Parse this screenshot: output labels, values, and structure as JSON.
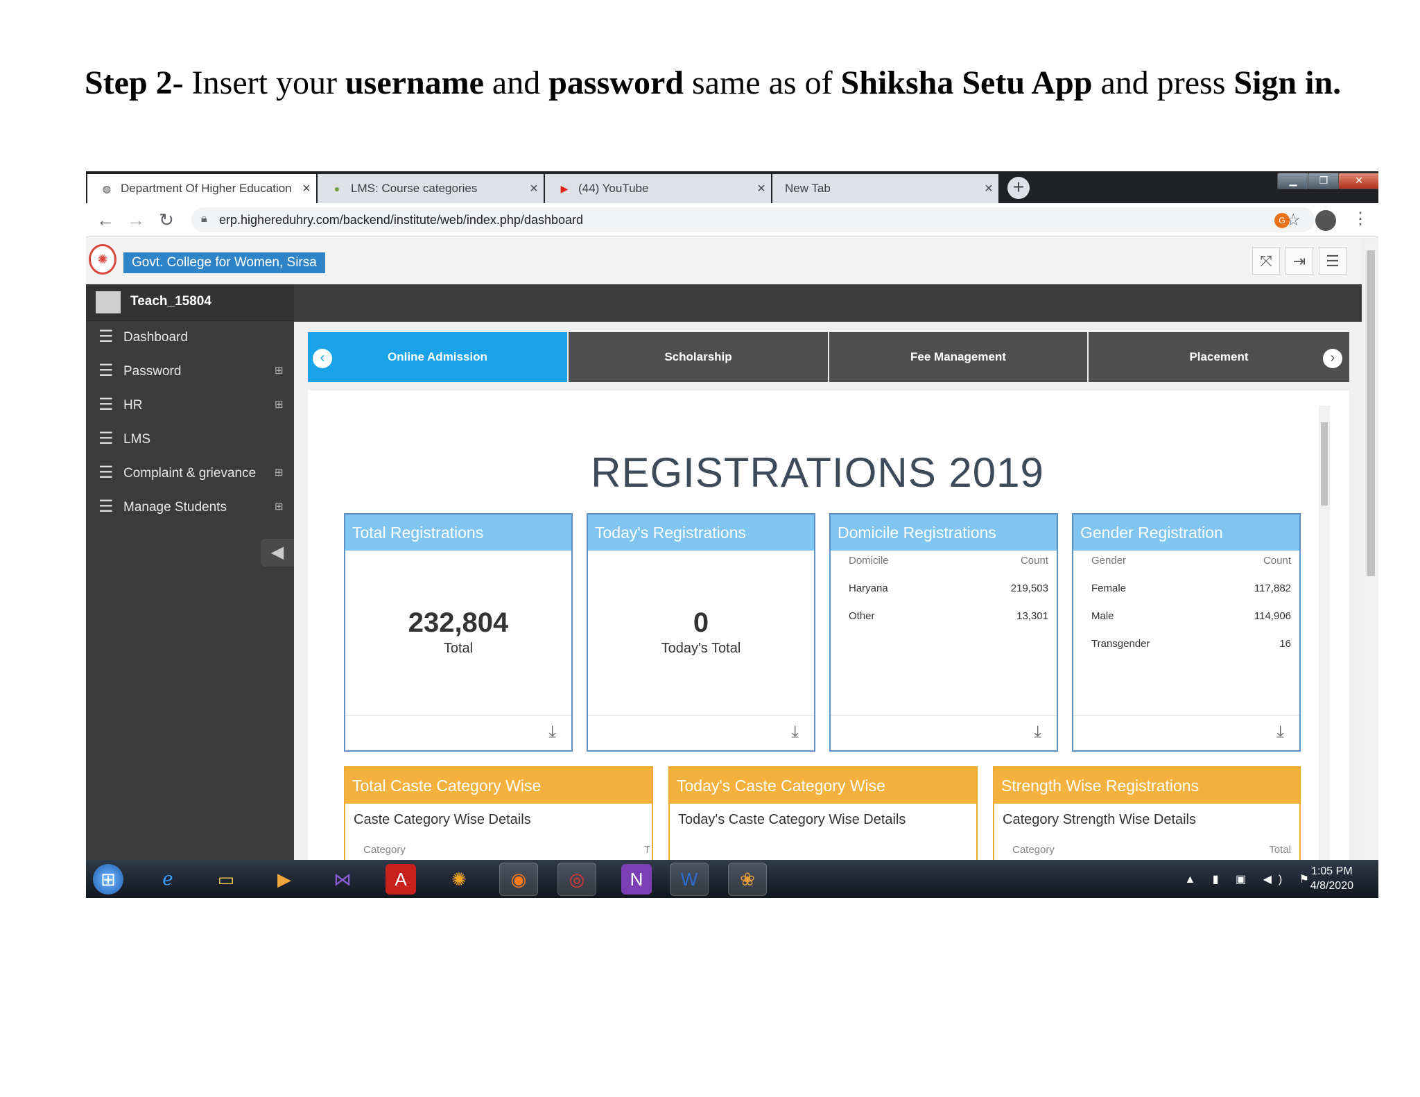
{
  "instruction": {
    "step_label": "Step 2-",
    "text_1": " Insert your ",
    "bold_1": "username",
    "text_2": " and ",
    "bold_2": "password",
    "text_3": " same as of ",
    "bold_3": "Shiksha Setu App",
    "text_4": " and press ",
    "bold_4": "Sign in."
  },
  "browser": {
    "tabs": [
      {
        "title": "Department Of Higher Education",
        "icon": "globe-icon",
        "active": true
      },
      {
        "title": "LMS: Course categories",
        "icon": "moodle-icon",
        "active": false
      },
      {
        "title": "(44) YouTube",
        "icon": "youtube-icon",
        "active": false
      },
      {
        "title": "New Tab",
        "icon": "none",
        "active": false
      }
    ],
    "url": "erp.higheredu hry.com/backend/institute/web/index.php/dashboard",
    "url_display": "erp.higheredu​hry.com/backend/institute/web/index.php/dashboard"
  },
  "app": {
    "college_name": "Govt. College for Women, Sirsa",
    "user": "Teach_15804",
    "menu": [
      {
        "label": "Dashboard",
        "expandable": false
      },
      {
        "label": "Password",
        "expandable": true
      },
      {
        "label": "HR",
        "expandable": true
      },
      {
        "label": "LMS",
        "expandable": false
      },
      {
        "label": "Complaint & grievance",
        "expandable": true
      },
      {
        "label": "Manage Students",
        "expandable": true
      }
    ],
    "modules": [
      "Online Admission",
      "Scholarship",
      "Fee Management",
      "Placement"
    ],
    "active_module": "Online Admission",
    "page_title": "REGISTRATIONS 2019",
    "cards": {
      "total": {
        "title": "Total Registrations",
        "value": "232,804",
        "caption": "Total"
      },
      "today": {
        "title": "Today's Registrations",
        "value": "0",
        "caption": "Today's Total"
      },
      "domicile": {
        "title": "Domicile Registrations",
        "col1": "Domicile",
        "col2": "Count",
        "rows": [
          {
            "name": "Haryana",
            "count": "219,503"
          },
          {
            "name": "Other",
            "count": "13,301"
          }
        ]
      },
      "gender": {
        "title": "Gender Registration",
        "col1": "Gender",
        "col2": "Count",
        "rows": [
          {
            "name": "Female",
            "count": "117,882"
          },
          {
            "name": "Male",
            "count": "114,906"
          },
          {
            "name": "Transgender",
            "count": "16"
          }
        ]
      },
      "caste_total": {
        "title": "Total Caste Category Wise",
        "subtitle": "Caste Category Wise Details",
        "col1": "Category",
        "col2": "T"
      },
      "caste_today": {
        "title": "Today's Caste Category Wise",
        "subtitle": "Today's Caste Category Wise Details"
      },
      "strength": {
        "title": "Strength Wise Registrations",
        "subtitle": "Category Strength Wise Details",
        "col1": "Category",
        "col2": "Total"
      }
    }
  },
  "taskbar": {
    "time": "1:05 PM",
    "date": "4/8/2020",
    "pinned": [
      "start-orb",
      "internet-explorer",
      "file-explorer",
      "media-player",
      "visual-studio",
      "acrobat",
      "app-orange",
      "firefox",
      "chrome",
      "onenote",
      "word",
      "app-misc"
    ]
  }
}
